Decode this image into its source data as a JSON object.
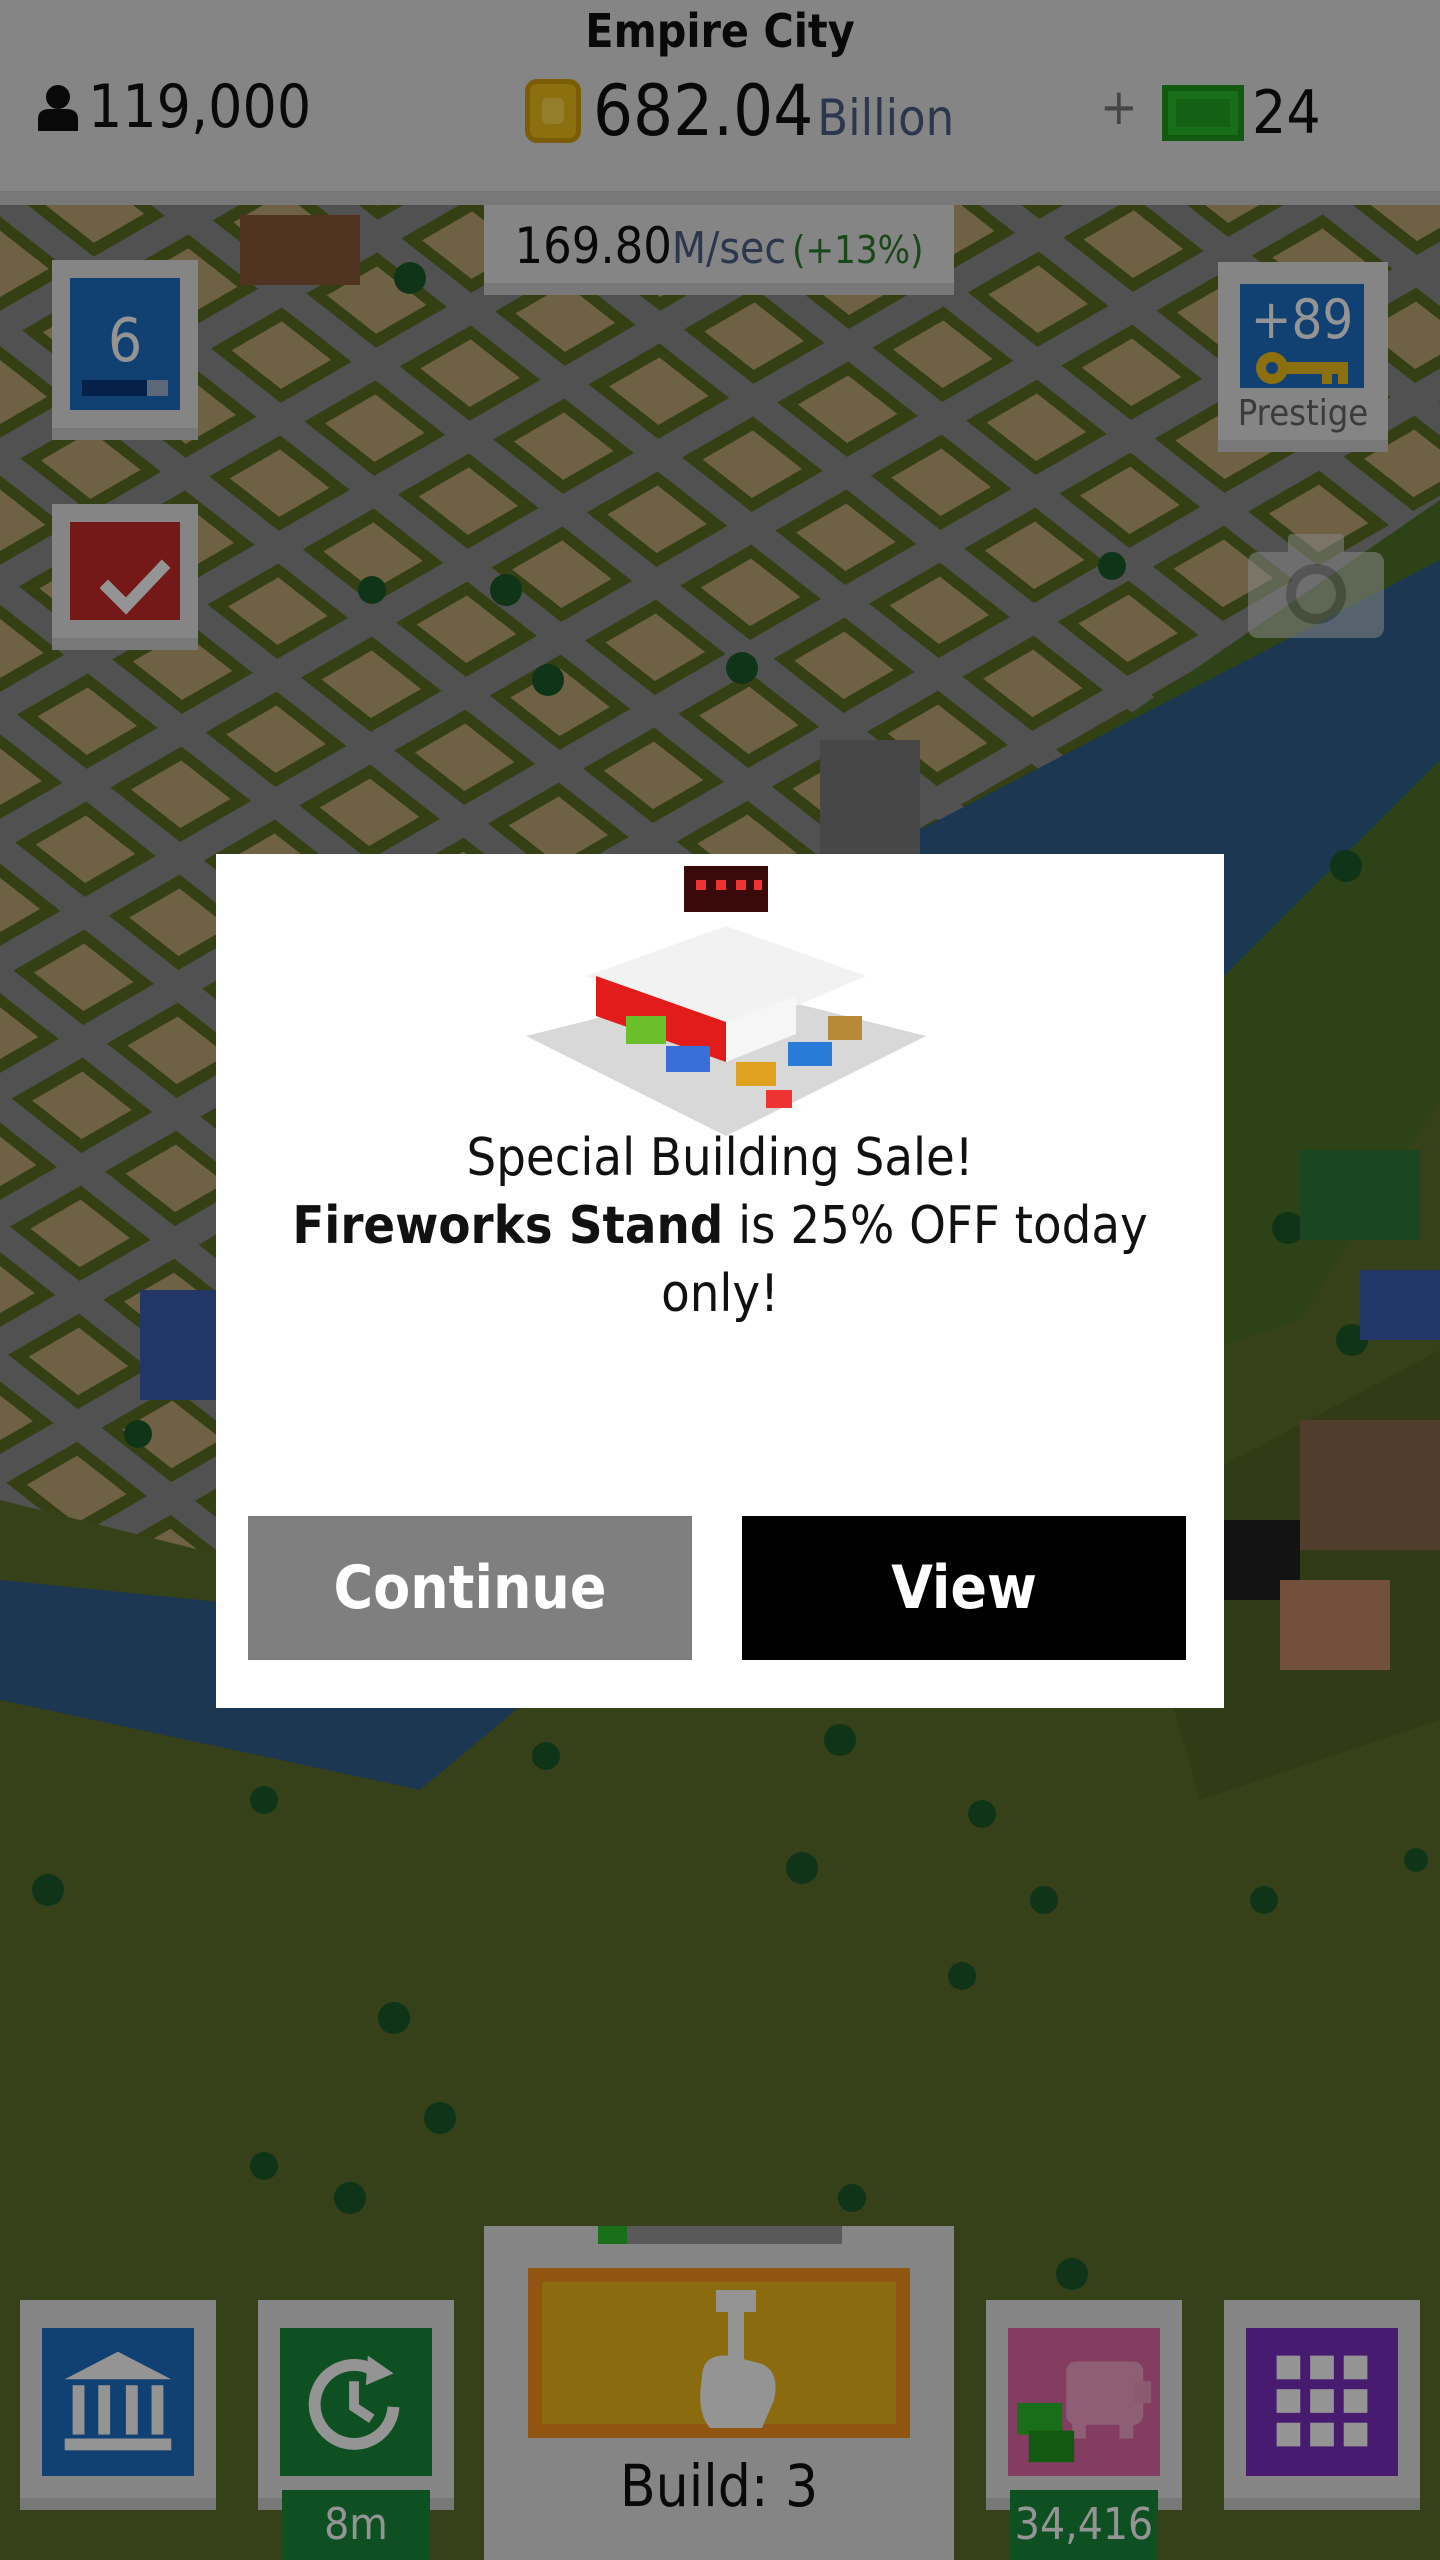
{
  "hud": {
    "city_name": "Empire City",
    "population": "119,000",
    "money_amount": "682.04",
    "money_unit": "Billion",
    "plus": "+",
    "cash": "24",
    "income_value": "169.80",
    "income_unit": "M/sec",
    "income_bonus": "(+13%)",
    "level": "6",
    "level_progress": 0.75,
    "prestige_value": "+89",
    "prestige_label": "Prestige"
  },
  "bottom": {
    "timer_badge": "8m",
    "savings_badge": "34,416",
    "build_label": "Build: 3",
    "build_progress": 0.12
  },
  "modal": {
    "line1": "Special Building Sale!",
    "building_name": "Fireworks Stand",
    "line2_rest": " is 25% OFF today only!",
    "continue_label": "Continue",
    "view_label": "View"
  },
  "colors": {
    "grass": "#5e6f2c",
    "road": "#8c8c8c",
    "lot": "#bfa774",
    "water": "#2f5f8c",
    "hud_bg": "#e6e6e6",
    "level_blue": "#1e6fc4",
    "check_red": "#c92a2a",
    "timer_green": "#1b8a3b",
    "build_yellow": "#f0b81a",
    "savings_pink": "#e26aa6",
    "grid_purple": "#7b2fbf"
  }
}
